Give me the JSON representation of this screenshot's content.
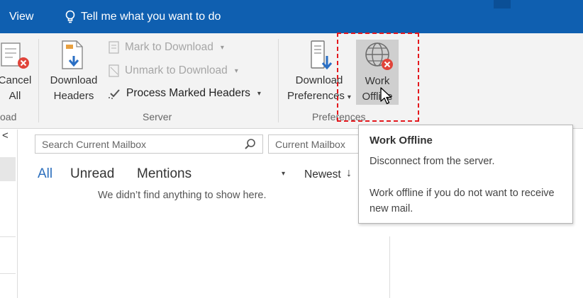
{
  "title_bar": {
    "view_tab": "View",
    "tell_me": "Tell me what you want to do"
  },
  "ribbon": {
    "cancel_all": {
      "line1": "Cancel",
      "line2": "All"
    },
    "partial_group_label": "oad",
    "server_group": {
      "label": "Server",
      "download_headers": {
        "line1": "Download",
        "line2": "Headers"
      },
      "mark_to_download": "Mark to Download",
      "unmark_to_download": "Unmark to Download",
      "process_marked_headers": "Process Marked Headers"
    },
    "preferences_group": {
      "label": "Preferences",
      "download_preferences": {
        "line1": "Download",
        "line2": "Preferences"
      },
      "work_offline": {
        "line1": "Work",
        "line2": "Offline"
      }
    }
  },
  "mail_list": {
    "search_placeholder": "Search Current Mailbox",
    "search_scope": "Current Mailbox",
    "filters": [
      "All",
      "Unread",
      "Mentions"
    ],
    "sort": "Newest",
    "empty_message": "We didn’t find anything to show here."
  },
  "tooltip": {
    "title": "Work Offline",
    "line1": "Disconnect from the server.",
    "line2": "Work offline if you do not want to receive new mail."
  },
  "colors": {
    "title_bar": "#0f5fb0",
    "ribbon_bg": "#f3f3f3",
    "highlight_box": "#e4181d",
    "active_filter": "#2c6fbd"
  }
}
